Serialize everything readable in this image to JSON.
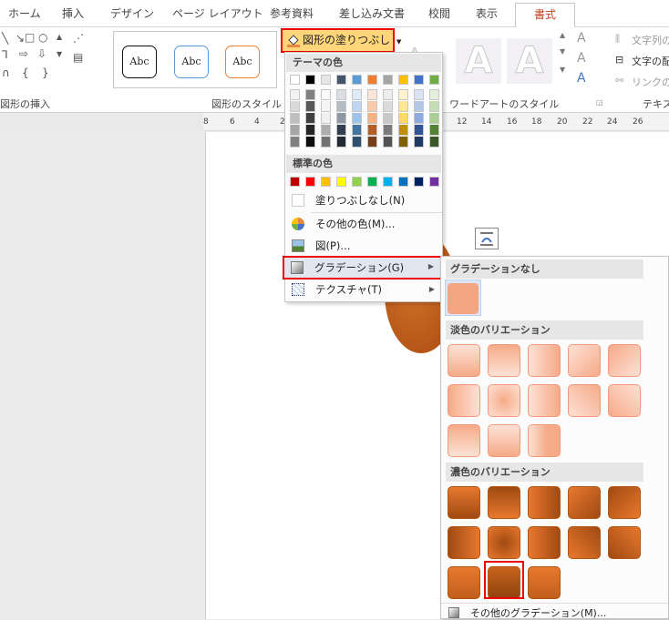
{
  "tabs": {
    "home": "ホーム",
    "insert": "挿入",
    "design": "デザイン",
    "page_layout": "ページ レイアウト",
    "references": "参考資料",
    "mailings": "差し込み文書",
    "review": "校閲",
    "view": "表示",
    "format": "書式"
  },
  "ribbon": {
    "group_insert_shapes": "図形の挿入",
    "group_shape_styles": "図形のスタイル",
    "group_wordart": "ワードアートのスタイル",
    "group_text": "テキス",
    "style_label": "Abc",
    "text_direction": "文字列の",
    "text_align": "文字の配",
    "link": "リンクの作"
  },
  "shape_fill_button": "図形の塗りつぶし",
  "fill_menu": {
    "theme_colors_header": "テーマの色",
    "standard_colors_header": "標準の色",
    "no_fill": "塗りつぶしなし(N)",
    "more_colors": "その他の色(M)...",
    "picture": "図(P)...",
    "gradient": "グラデーション(G)",
    "texture": "テクスチャ(T)",
    "theme_colors": [
      "#ffffff",
      "#000000",
      "#e7e6e6",
      "#44546a",
      "#5b9bd5",
      "#ed7d31",
      "#a5a5a5",
      "#ffc000",
      "#4472c4",
      "#70ad47"
    ],
    "standard_colors": [
      "#c00000",
      "#ff0000",
      "#ffc000",
      "#ffff00",
      "#92d050",
      "#00b050",
      "#00b0f0",
      "#0070c0",
      "#002060",
      "#7030a0"
    ]
  },
  "gradient_menu": {
    "no_gradient_header": "グラデーションなし",
    "light_header": "淡色のバリエーション",
    "dark_header": "濃色のバリエーション",
    "more_gradients": "その他のグラデーション(M)..."
  },
  "ruler_numbers": [
    "8",
    "6",
    "4",
    "2",
    "12",
    "14",
    "16",
    "18",
    "20",
    "22",
    "24",
    "26"
  ]
}
